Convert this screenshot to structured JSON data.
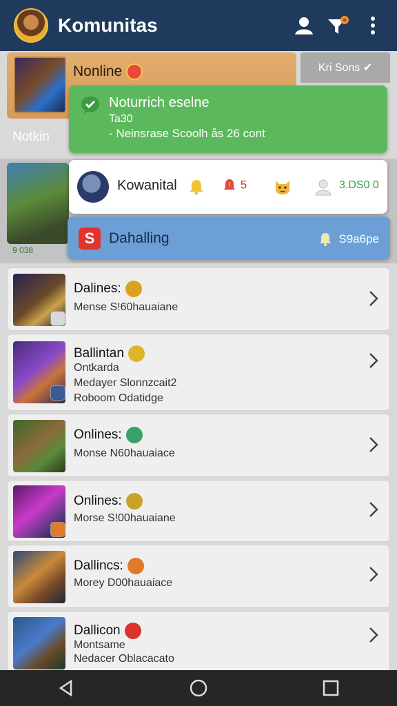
{
  "app": {
    "title": "Komunitas"
  },
  "hero": {
    "title": "Nonline",
    "chip": "Kri Sons ✔"
  },
  "side": {
    "label": "Notkin",
    "count": "9 038"
  },
  "notif_green": {
    "title": "Noturrich eselne",
    "sub": "Ta30",
    "line": "- Neinsrase Scoolh ås 26 cont"
  },
  "notif_white": {
    "name": "Kowanital",
    "alert_count": "5",
    "value": "3.DS0 0"
  },
  "notif_blue": {
    "logo": "S",
    "title": "Dahalling",
    "right": "S9a6pe"
  },
  "list": [
    {
      "title": "Dalines:",
      "badge_color": "#d9a21f",
      "lines": [
        "Mense S!60hauaiane"
      ]
    },
    {
      "title": "Ballintan",
      "badge_color": "#e0b52a",
      "lines": [
        "Ontkarda",
        "Medayer Slonnzcait2",
        "Roboom Odatidge"
      ]
    },
    {
      "title": "Onlines:",
      "badge_color": "#3aa06a",
      "lines": [
        "Monse N60hauaiace"
      ]
    },
    {
      "title": "Onlines:",
      "badge_color": "#c9a227",
      "lines": [
        "Morse S!00hauaiane"
      ]
    },
    {
      "title": "Dallincs:",
      "badge_color": "#e07a2a",
      "lines": [
        "Morey D00hauaiace"
      ]
    },
    {
      "title": "Dallicon",
      "badge_color": "#d9342b",
      "lines": [
        "Montsame",
        "Nedacer Oblacacato"
      ]
    }
  ]
}
